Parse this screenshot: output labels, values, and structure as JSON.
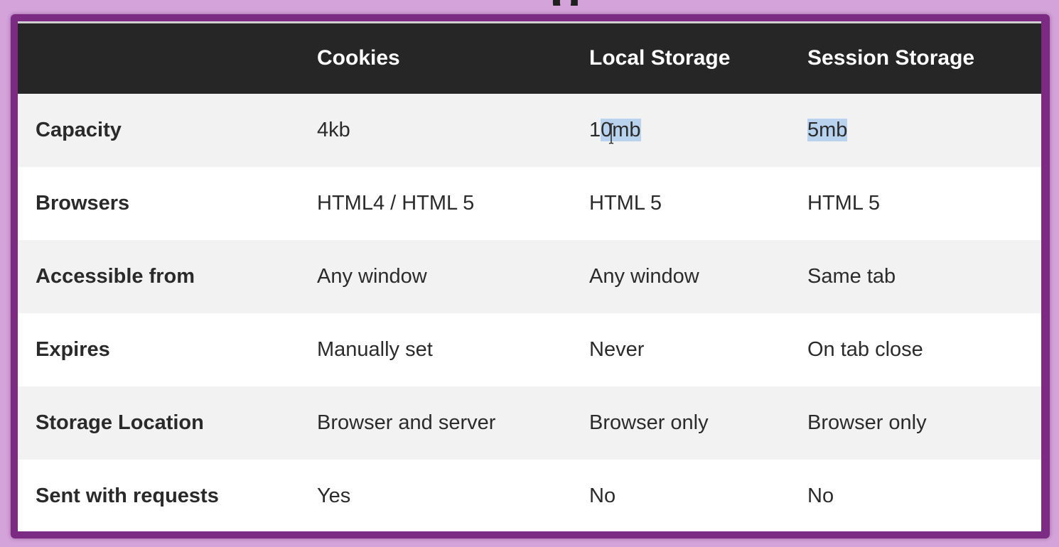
{
  "title_fragment": "g",
  "table": {
    "headers": [
      "",
      "Cookies",
      "Local Storage",
      "Session Storage"
    ],
    "rows": [
      {
        "label": "Capacity",
        "cookies": "4kb",
        "local": "10mb",
        "session": "5mb"
      },
      {
        "label": "Browsers",
        "cookies": "HTML4 / HTML 5",
        "local": "HTML 5",
        "session": "HTML 5"
      },
      {
        "label": "Accessible from",
        "cookies": "Any window",
        "local": "Any window",
        "session": "Same tab"
      },
      {
        "label": "Expires",
        "cookies": "Manually set",
        "local": "Never",
        "session": "On tab close"
      },
      {
        "label": "Storage Location",
        "cookies": "Browser and server",
        "local": "Browser only",
        "session": "Browser only"
      },
      {
        "label": "Sent with requests",
        "cookies": "Yes",
        "local": "No",
        "session": "No"
      }
    ]
  },
  "selection": {
    "local_prefix": "1",
    "local_selected": "0mb",
    "session_selected": "5mb"
  },
  "colors": {
    "header_bg": "#262626",
    "selection": "#b9d3ee",
    "frame": "#7b2c82",
    "background": "#d4a3d9"
  }
}
